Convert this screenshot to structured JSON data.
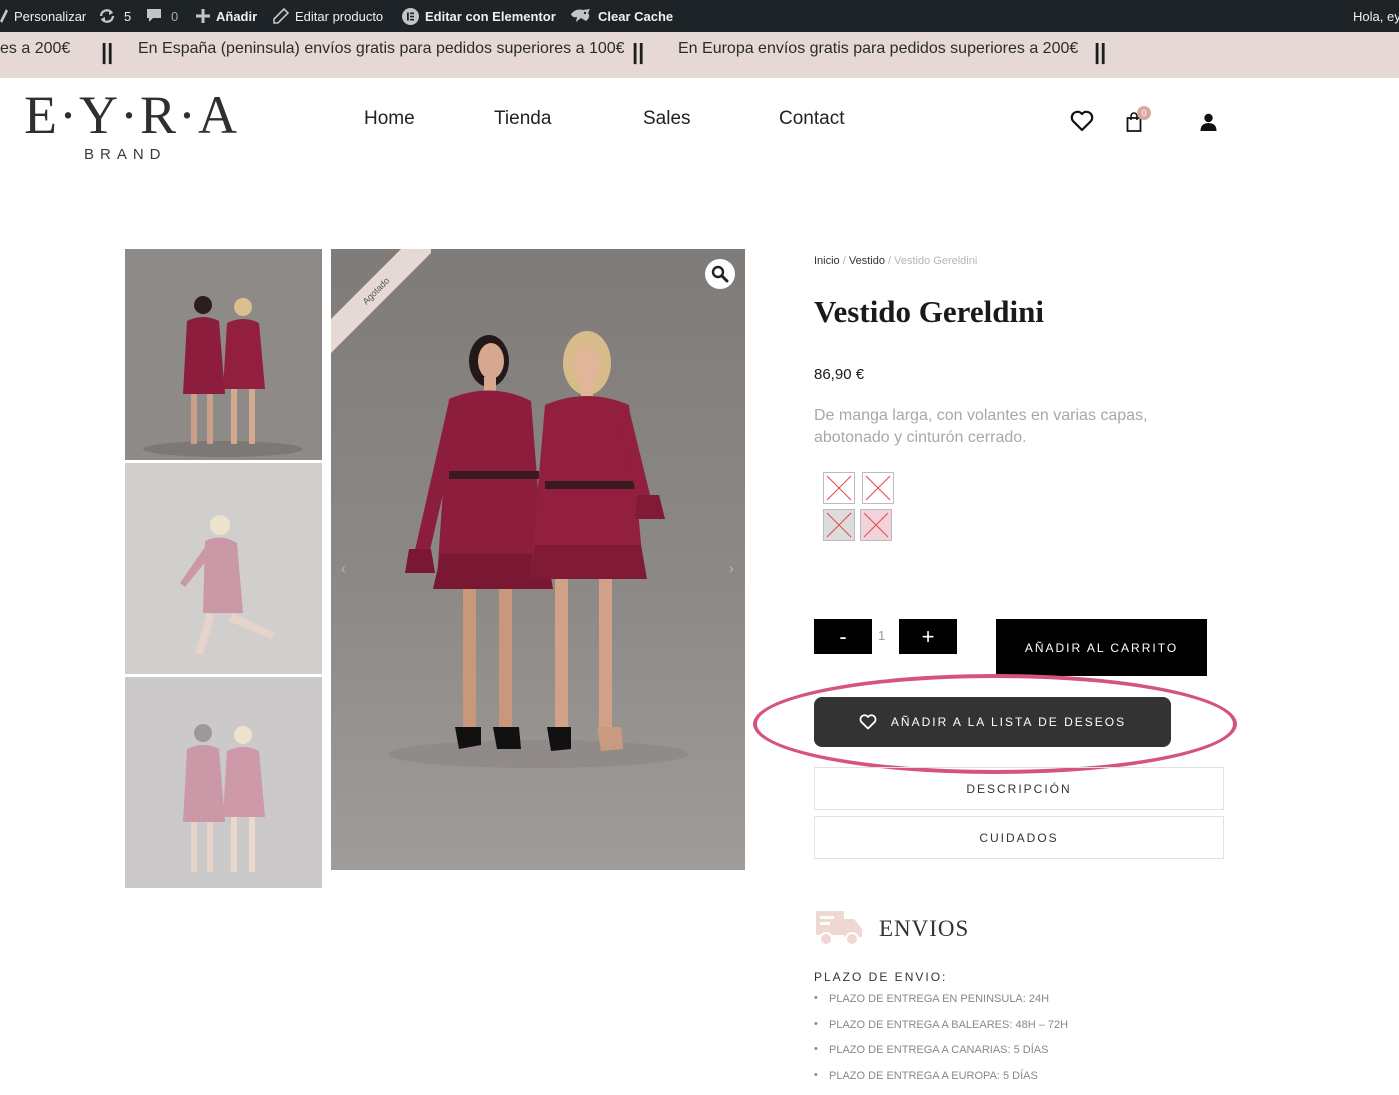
{
  "admin_bar": {
    "customize": "Personalizar",
    "updates_count": "5",
    "comments_count": "0",
    "add_new": "Añadir",
    "edit_product": "Editar producto",
    "elementor": "Editar con Elementor",
    "clear_cache": "Clear Cache",
    "greeting": "Hola, ey"
  },
  "announcement": {
    "left_fragment": "es a 200€",
    "message_spain": "En España (peninsula) envíos gratis para pedidos superiores a 100€",
    "message_europe": "En Europa envíos gratis para pedidos superiores a 200€",
    "separator": "||"
  },
  "header": {
    "logo_main": "E·Y·R·A",
    "logo_sub": "BRAND",
    "nav": [
      "Home",
      "Tienda",
      "Sales",
      "Contact"
    ],
    "cart_count": "0"
  },
  "gallery": {
    "badge": "Agotado"
  },
  "product": {
    "breadcrumb": [
      "Inicio",
      "Vestido",
      "Vestido Gereldini"
    ],
    "breadcrumb_sep": " / ",
    "title": "Vestido Gereldini",
    "price": "86,90 €",
    "description": "De manga larga, con volantes en varias capas, abotonado y cinturón cerrado.",
    "qty_minus": "-",
    "qty_value": "1",
    "qty_plus": "+",
    "add_to_cart": "AÑADIR AL CARRITO",
    "wishlist": "AÑADIR A LA LISTA DE DESEOS",
    "tabs": [
      "DESCRIPCIÓN",
      "CUIDADOS"
    ]
  },
  "shipping": {
    "title": "ENVIOS",
    "subtitle": "PLAZO DE ENVIO:",
    "items": [
      "PLAZO DE ENTREGA EN PENINSULA: 24H",
      "PLAZO DE ENTREGA A BALEARES: 48H – 72H",
      "PLAZO DE ENTREGA A CANARIAS: 5 DÍAS",
      "PLAZO DE ENTREGA A EUROPA: 5 DÍAS"
    ]
  },
  "colors": {
    "admin_bar": "#1d2327",
    "announcement_bg": "#e5d8d5",
    "highlight_ring": "#d5547f",
    "wishlist_bg": "#333333",
    "dress": "#8c1d3c"
  }
}
